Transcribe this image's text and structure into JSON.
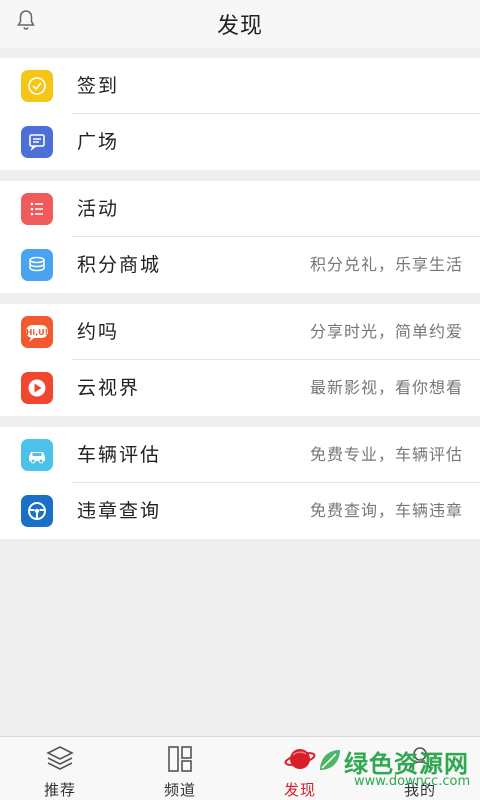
{
  "header": {
    "title": "发现",
    "bell_icon": "bell-icon"
  },
  "groups": [
    {
      "items": [
        {
          "label": "签到",
          "desc": "",
          "icon": "checkin-icon",
          "color": "#f5c518"
        },
        {
          "label": "广场",
          "desc": "",
          "icon": "square-icon",
          "color": "#4f6fd8"
        }
      ]
    },
    {
      "items": [
        {
          "label": "活动",
          "desc": "",
          "icon": "activity-icon",
          "color": "#ef5b5b"
        },
        {
          "label": "积分商城",
          "desc": "积分兑礼，乐享生活",
          "icon": "points-mall-icon",
          "color": "#4aa3ee"
        }
      ]
    },
    {
      "items": [
        {
          "label": "约吗",
          "desc": "分享时光，简单约爱",
          "icon": "dating-icon",
          "color": "#f25a2e"
        },
        {
          "label": "云视界",
          "desc": "最新影视，看你想看",
          "icon": "video-icon",
          "color": "#f0472e"
        }
      ]
    },
    {
      "items": [
        {
          "label": "车辆评估",
          "desc": "免费专业，车辆评估",
          "icon": "car-icon",
          "color": "#4cc2e8"
        },
        {
          "label": "违章查询",
          "desc": "免费查询，车辆违章",
          "icon": "steering-wheel-icon",
          "color": "#1a6fc9"
        }
      ]
    }
  ],
  "tabs": [
    {
      "label": "推荐",
      "icon": "layers-icon",
      "active": false
    },
    {
      "label": "频道",
      "icon": "channel-grid-icon",
      "active": false
    },
    {
      "label": "发现",
      "icon": "planet-icon",
      "active": true
    },
    {
      "label": "我的",
      "icon": "user-icon",
      "active": false
    }
  ],
  "watermark": {
    "text": "绿色资源网",
    "url": "www.downcc.com"
  }
}
